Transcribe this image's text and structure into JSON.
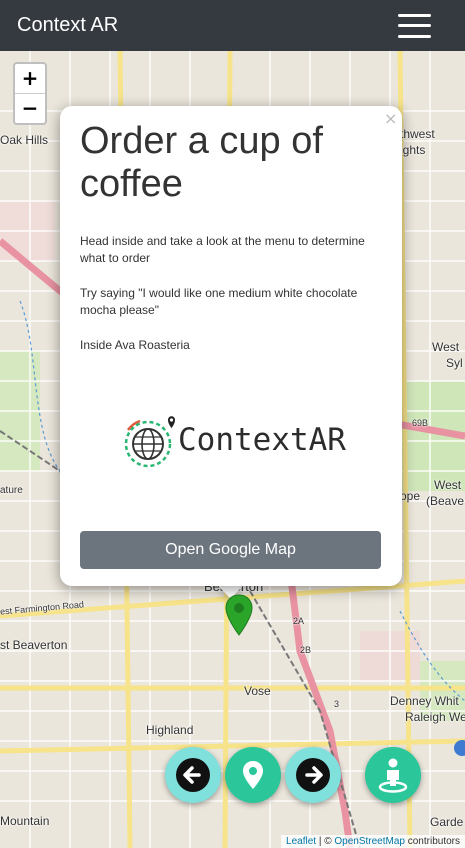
{
  "navbar": {
    "brand": "Context AR",
    "menu_icon": "hamburger-icon"
  },
  "map": {
    "zoom_in_label": "+",
    "zoom_out_label": "−",
    "labels": {
      "oak_hills": "Oak Hills",
      "northwest": "thwest",
      "heights": "ights",
      "west_syl": "West",
      "syl": "Syl",
      "west_beav": "West",
      "beav": "(Beave",
      "ope": "ope",
      "farmington": "est Farmington Road",
      "w_beaverton": "st Beaverton",
      "beaverton": "Beaverton",
      "vose": "Vose",
      "highland": "Highland",
      "denney": "Denney Whit",
      "raleigh": "Raleigh We",
      "mountain": "Mountain",
      "garde": "Garde",
      "ature": "ature",
      "hwy_2a": "2A",
      "hwy_2b": "2B",
      "hwy_3": "3",
      "hwy_69b": "69B"
    },
    "attribution": {
      "leaflet": "Leaflet",
      "separator": " | © ",
      "osm": "OpenStreetMap",
      "suffix": " contributors"
    }
  },
  "popup": {
    "close_label": "×",
    "title": "Order a cup of coffee",
    "instruction": "Head inside and take a look at the menu to determine what to order",
    "phrase": "Try saying \"I would like one medium white chocolate mocha please\"",
    "location": "Inside Ava Roasteria",
    "logo_text": "ContextAR",
    "button_label": "Open Google Map"
  },
  "fabs": [
    {
      "name": "previous-button",
      "icon": "arrow-left-icon",
      "color": "#7fe0dc"
    },
    {
      "name": "location-button",
      "icon": "map-pin-icon",
      "color": "#2bc79a"
    },
    {
      "name": "next-button",
      "icon": "arrow-right-icon",
      "color": "#7fe0dc"
    },
    {
      "name": "ar-view-button",
      "icon": "person-pin-icon",
      "color": "#2bc79a"
    }
  ],
  "colors": {
    "navbar": "#343a40",
    "button": "#6c757d",
    "marker": "#2aa52a"
  }
}
